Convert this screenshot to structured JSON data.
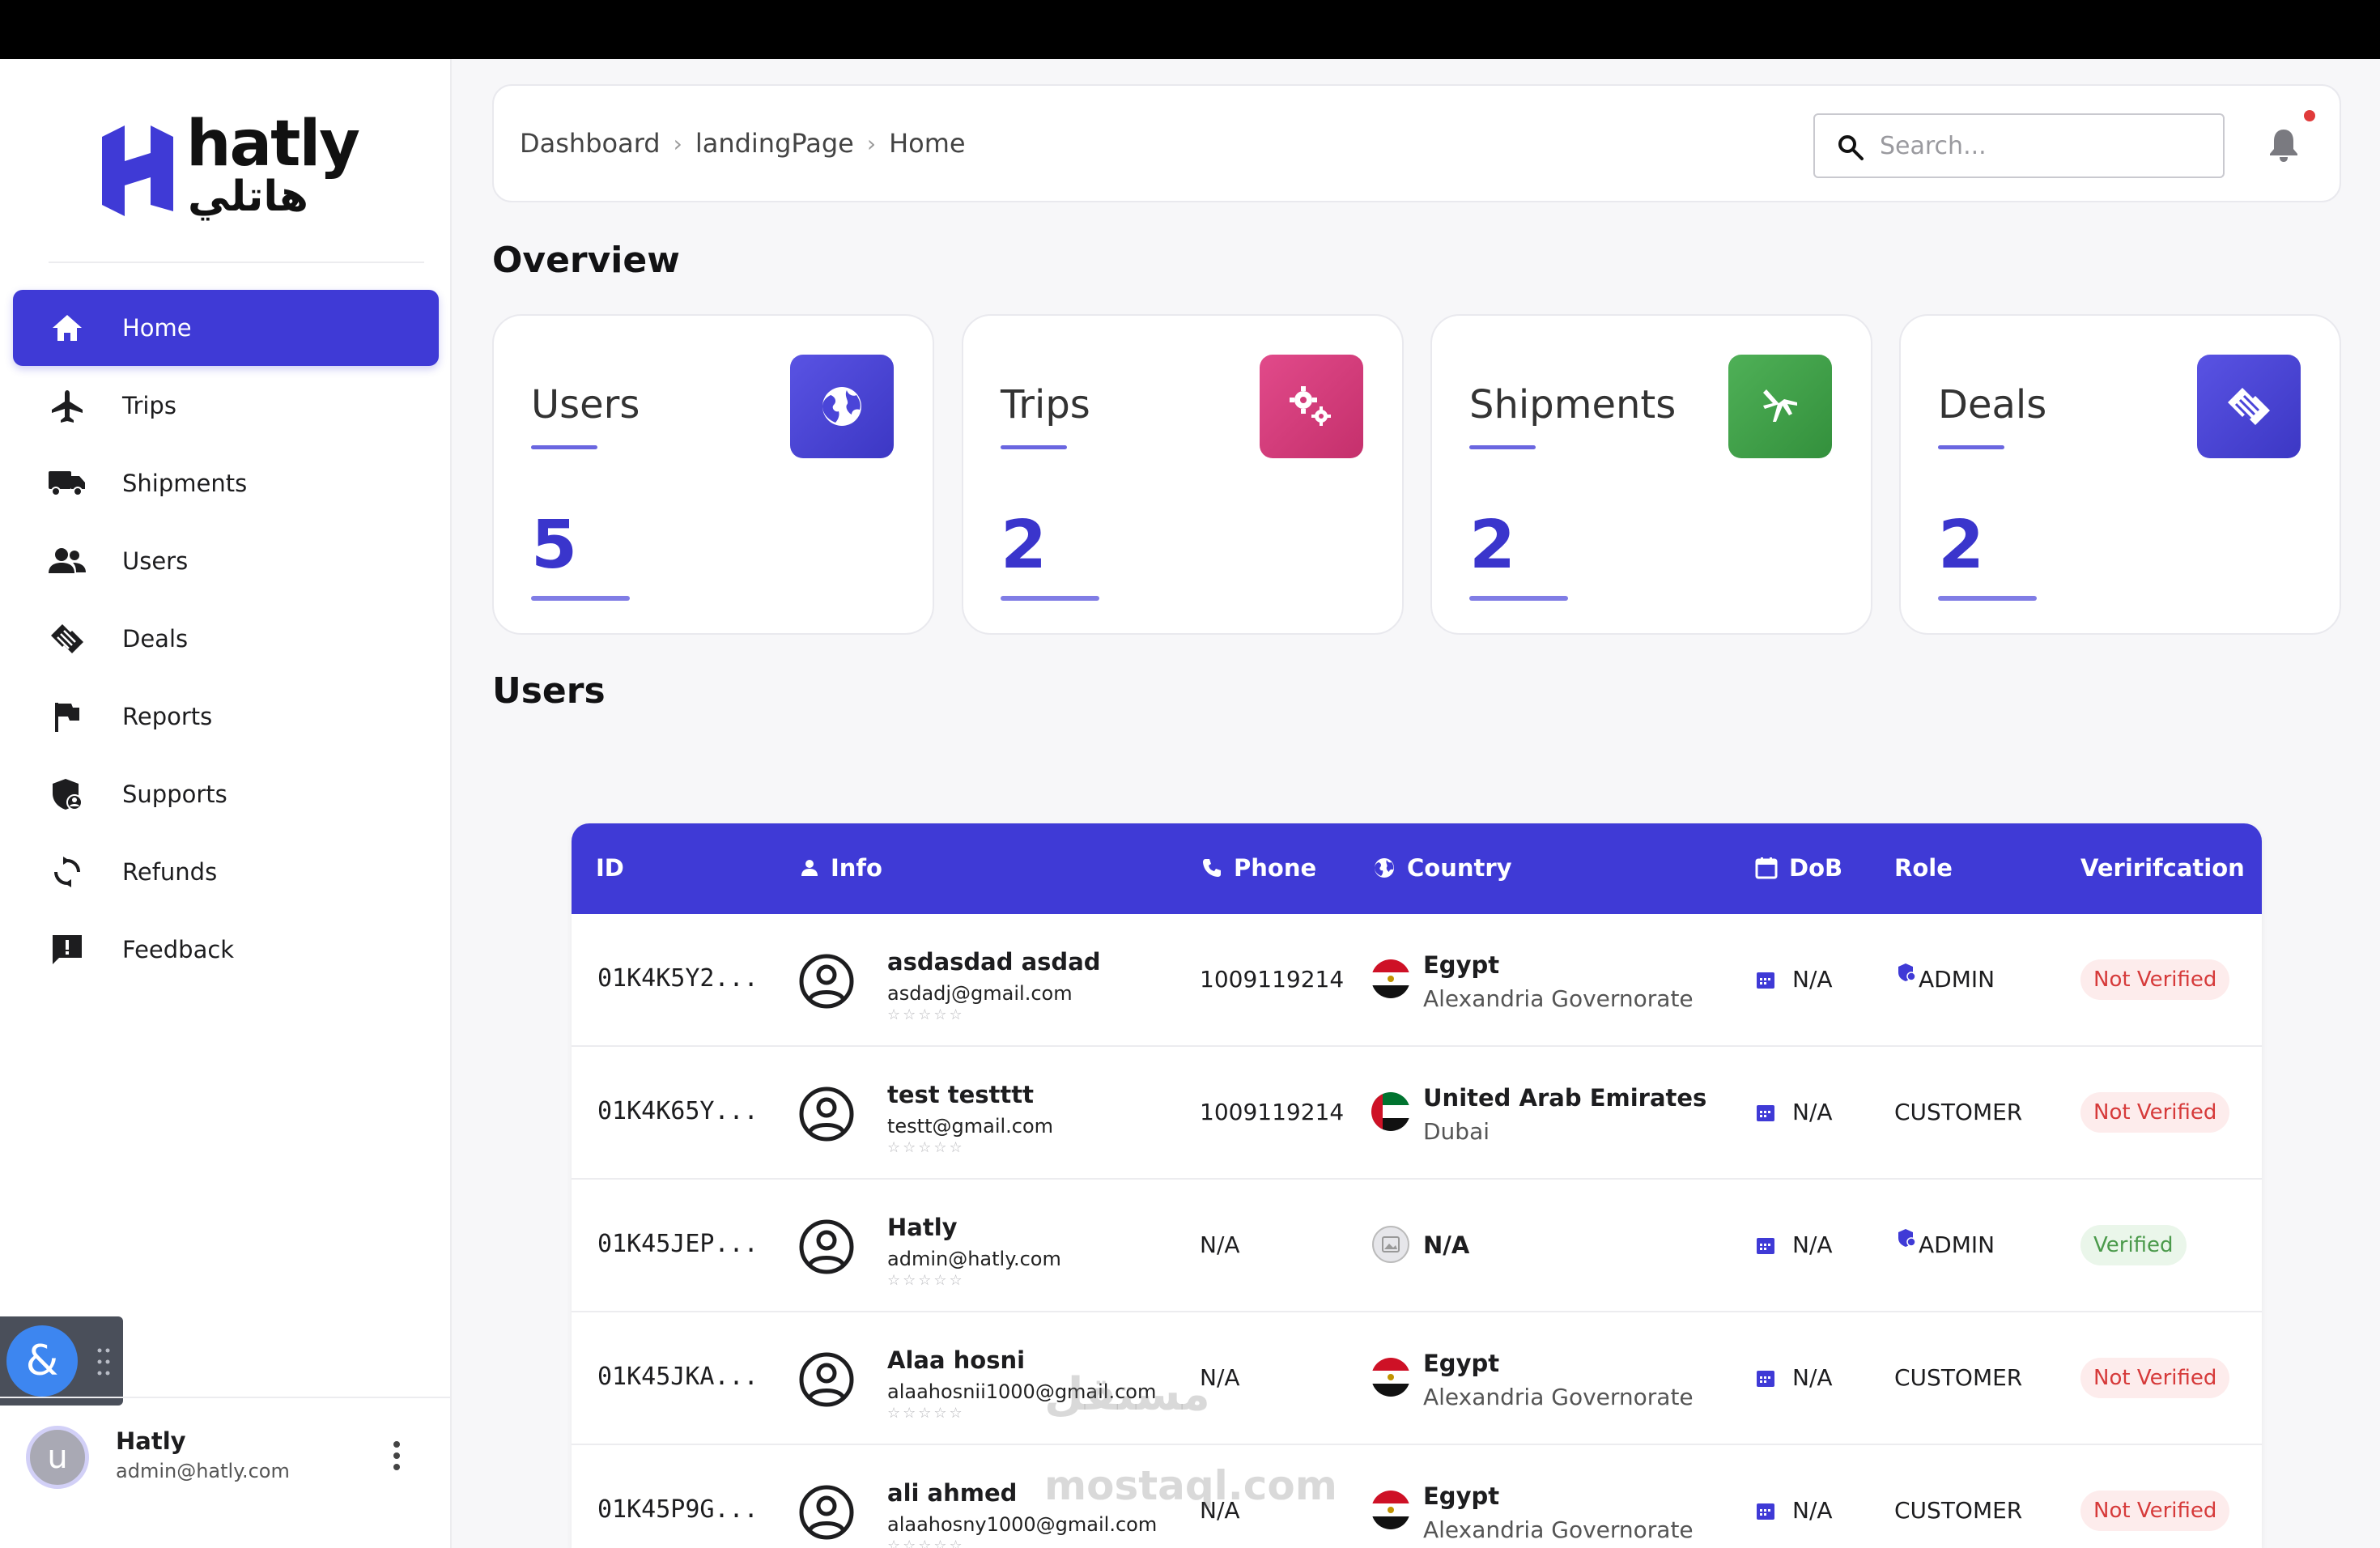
{
  "brand": {
    "name": "hatly",
    "arabic_name": "هاتلي",
    "accent": "#3f3ad6"
  },
  "sidebar": {
    "items": [
      {
        "label": "Home",
        "icon": "home-icon",
        "active": true
      },
      {
        "label": "Trips",
        "icon": "airplane-icon",
        "active": false
      },
      {
        "label": "Shipments",
        "icon": "truck-icon",
        "active": false
      },
      {
        "label": "Users",
        "icon": "users-icon",
        "active": false
      },
      {
        "label": "Deals",
        "icon": "handshake-icon",
        "active": false
      },
      {
        "label": "Reports",
        "icon": "flag-icon",
        "active": false
      },
      {
        "label": "Supports",
        "icon": "shield-person-icon",
        "active": false
      },
      {
        "label": "Refunds",
        "icon": "refresh-icon",
        "active": false
      },
      {
        "label": "Feedback",
        "icon": "feedback-icon",
        "active": false
      }
    ],
    "floating_button": "&",
    "user": {
      "avatar_letter": "u",
      "name": "Hatly",
      "email": "admin@hatly.com"
    }
  },
  "header": {
    "breadcrumb": [
      "Dashboard",
      "landingPage",
      "Home"
    ],
    "search_placeholder": "Search..."
  },
  "overview": {
    "title": "Overview",
    "cards": [
      {
        "title": "Users",
        "value": "5",
        "icon": "globe-icon",
        "color": "#4a45d8"
      },
      {
        "title": "Trips",
        "value": "2",
        "icon": "gears-icon",
        "color": "#d23c7a"
      },
      {
        "title": "Shipments",
        "value": "2",
        "icon": "plane-crossing-icon",
        "color": "#3f9e48"
      },
      {
        "title": "Deals",
        "value": "2",
        "icon": "handshake-icon",
        "color": "#4a45d8"
      }
    ]
  },
  "users_section": {
    "title": "Users",
    "columns": {
      "id": "ID",
      "info": "Info",
      "phone": "Phone",
      "country": "Country",
      "dob": "DoB",
      "role": "Role",
      "verification": "Veririfcation"
    },
    "rows": [
      {
        "id": "01K4K5Y2...",
        "name": "asdasdad asdad",
        "email": "asdadj@gmail.com",
        "stars": "☆☆☆☆☆",
        "phone": "1009119214",
        "country": "Egypt",
        "region": "Alexandria Governorate",
        "flag": "egypt",
        "dob": "N/A",
        "role": "ADMIN",
        "verified": false,
        "verification": "Not Verified"
      },
      {
        "id": "01K4K65Y...",
        "name": "test testttt",
        "email": "testt@gmail.com",
        "stars": "☆☆☆☆☆",
        "phone": "1009119214",
        "country": "United Arab Emirates",
        "region": "Dubai",
        "flag": "uae",
        "dob": "N/A",
        "role": "CUSTOMER",
        "verified": false,
        "verification": "Not Verified"
      },
      {
        "id": "01K45JEP...",
        "name": "Hatly",
        "email": "admin@hatly.com",
        "stars": "☆☆☆☆☆",
        "phone": "N/A",
        "country": "N/A",
        "region": "",
        "flag": "none",
        "dob": "N/A",
        "role": "ADMIN",
        "verified": true,
        "verification": "Verified"
      },
      {
        "id": "01K45JKA...",
        "name": "Alaa hosni",
        "email": "alaahosnii1000@gmail.com",
        "stars": "☆☆☆☆☆",
        "phone": "N/A",
        "country": "Egypt",
        "region": "Alexandria Governorate",
        "flag": "egypt",
        "dob": "N/A",
        "role": "CUSTOMER",
        "verified": false,
        "verification": "Not Verified"
      },
      {
        "id": "01K45P9G...",
        "name": "ali ahmed",
        "email": "alaahosny1000@gmail.com",
        "stars": "☆☆☆☆☆",
        "phone": "N/A",
        "country": "Egypt",
        "region": "Alexandria Governorate",
        "flag": "egypt",
        "dob": "N/A",
        "role": "CUSTOMER",
        "verified": false,
        "verification": "Not Verified"
      }
    ]
  },
  "watermark": {
    "arabic": "مستقل",
    "latin": "mostaql.com"
  }
}
